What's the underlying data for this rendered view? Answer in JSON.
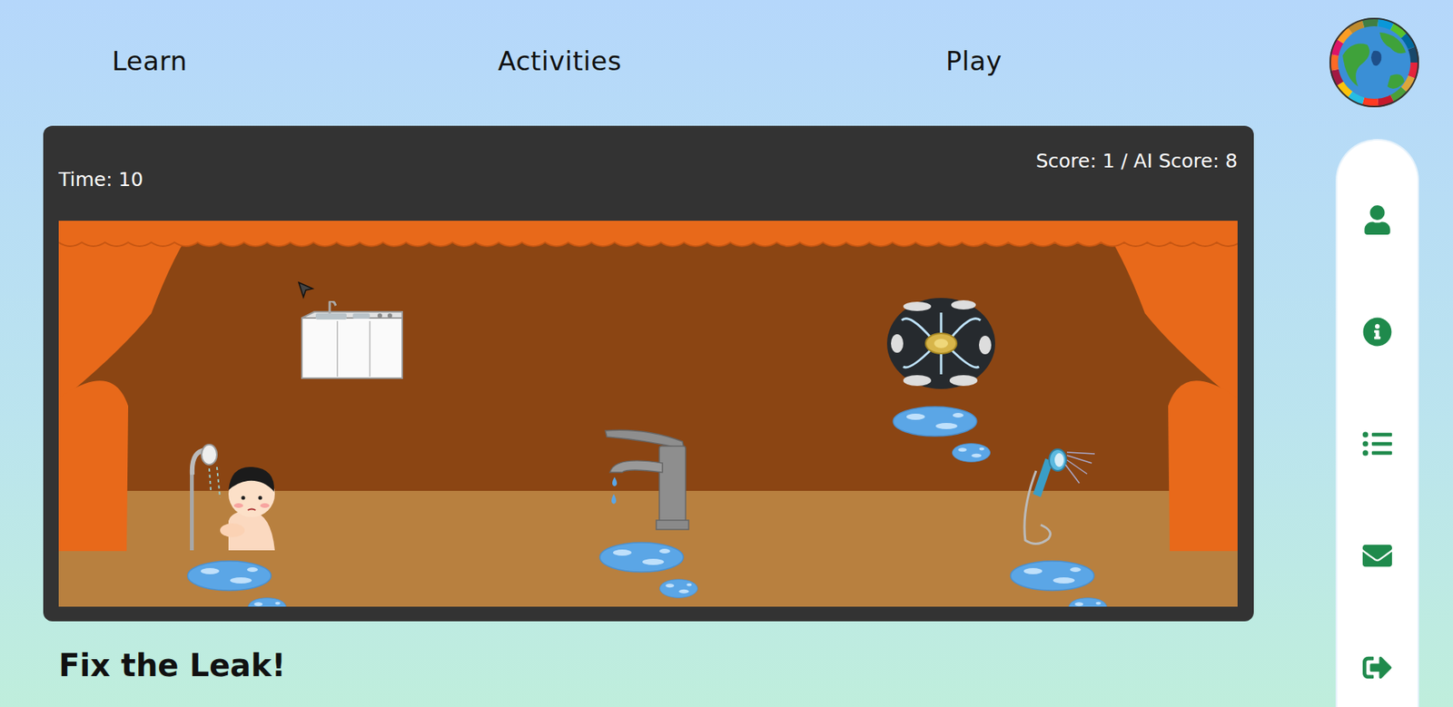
{
  "nav": [
    {
      "label": "Learn"
    },
    {
      "label": "Activities"
    },
    {
      "label": "Play"
    }
  ],
  "game": {
    "time": "Time: 10",
    "score": "Score: 1 / AI Score: 8",
    "stage": {
      "items": [
        {
          "kind": "sink",
          "leaking": false
        },
        {
          "kind": "shower-person",
          "leaking": true
        },
        {
          "kind": "faucet",
          "leaking": true
        },
        {
          "kind": "burst-pipe",
          "leaking": true
        },
        {
          "kind": "hand-shower",
          "leaking": true
        }
      ]
    }
  },
  "title": "Fix the Leak!"
}
